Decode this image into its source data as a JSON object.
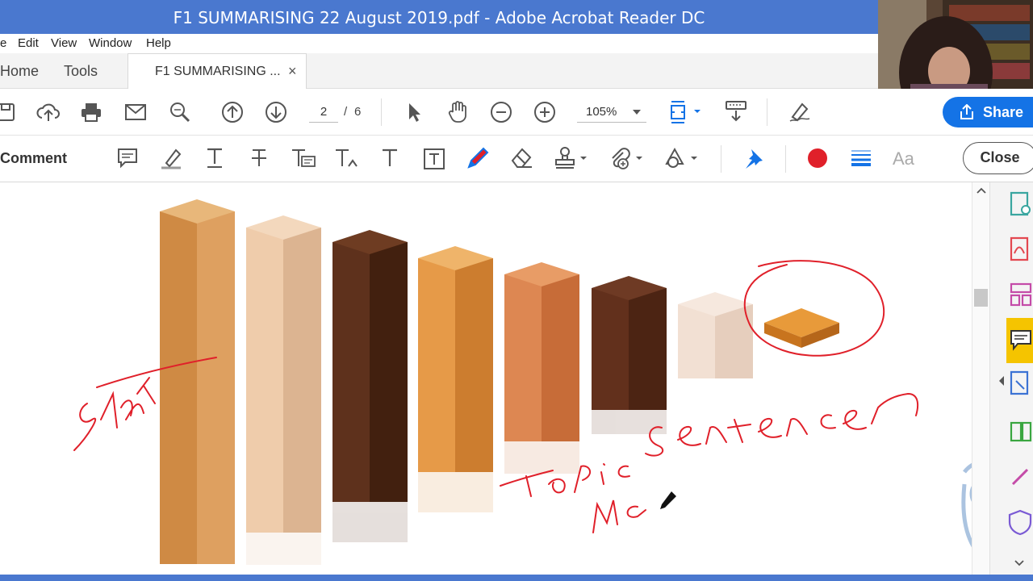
{
  "window": {
    "title": "F1 SUMMARISING 22 August 2019.pdf - Adobe Acrobat Reader DC"
  },
  "menu": {
    "file": "e",
    "edit": "Edit",
    "view": "View",
    "window": "Window",
    "help": "Help"
  },
  "tabs": {
    "home": "Home",
    "tools": "Tools",
    "document": "F1 SUMMARISING ...",
    "close_glyph": "×"
  },
  "toolbar": {
    "page_current": "2",
    "page_sep": "/",
    "page_total": "6",
    "zoom": "105%",
    "share_label": "Share"
  },
  "comment_toolbar": {
    "label": "Comment",
    "close_label": "Close",
    "text_props": "Aa",
    "active_color": "#e0202a"
  },
  "annotations": {
    "start": "START",
    "topic": "Topic",
    "sentence": "Sentence",
    "main": "Ma"
  },
  "colors": {
    "titlebar": "#4a78cf",
    "accent": "#1473e6",
    "ink": "#e0202a"
  }
}
